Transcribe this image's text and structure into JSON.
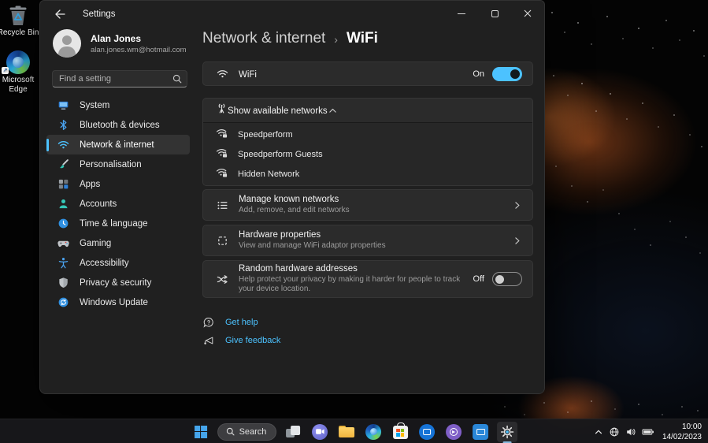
{
  "colors": {
    "accent": "#4cc2ff",
    "link": "#4cc2ff"
  },
  "desktop": {
    "icons": [
      {
        "label": "Recycle Bin"
      },
      {
        "label": "Microsoft Edge"
      }
    ]
  },
  "window": {
    "titlebar": {
      "title": "Settings"
    },
    "user": {
      "name": "Alan Jones",
      "email": "alan.jones.wm@hotmail.com"
    },
    "search": {
      "placeholder": "Find a setting"
    },
    "sidebar": [
      {
        "label": "System"
      },
      {
        "label": "Bluetooth & devices"
      },
      {
        "label": "Network & internet"
      },
      {
        "label": "Personalisation"
      },
      {
        "label": "Apps"
      },
      {
        "label": "Accounts"
      },
      {
        "label": "Time & language"
      },
      {
        "label": "Gaming"
      },
      {
        "label": "Accessibility"
      },
      {
        "label": "Privacy & security"
      },
      {
        "label": "Windows Update"
      }
    ],
    "breadcrumb": {
      "parent": "Network & internet",
      "separator": "›",
      "current": "WiFi"
    },
    "wifi_row": {
      "label": "WiFi",
      "state": "On"
    },
    "expander": {
      "label": "Show available networks",
      "networks": [
        "Speedperform",
        "Speedperform Guests",
        "Hidden Network"
      ]
    },
    "cards": {
      "manage": {
        "title": "Manage known networks",
        "subtitle": "Add, remove, and edit networks"
      },
      "hardware": {
        "title": "Hardware properties",
        "subtitle": "View and manage WiFi adaptor properties"
      },
      "random": {
        "title": "Random hardware addresses",
        "subtitle": "Help protect your privacy by making it harder for people to track your device location.",
        "state": "Off"
      }
    },
    "links": [
      {
        "label": "Get help"
      },
      {
        "label": "Give feedback"
      }
    ]
  },
  "taskbar": {
    "search_label": "Search",
    "clock": {
      "time": "10:00",
      "date": "14/02/2023"
    }
  }
}
